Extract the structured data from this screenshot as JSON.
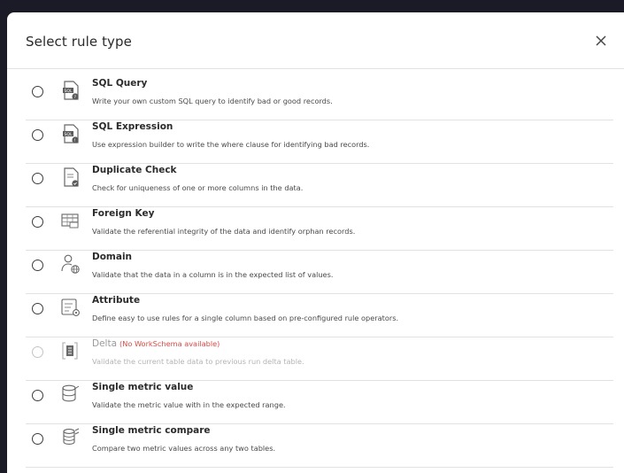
{
  "dialog": {
    "title": "Select rule type",
    "close_icon": "close-icon"
  },
  "rule_types": [
    {
      "name": "SQL Query",
      "description": "Write your own custom SQL query to identify bad or good records.",
      "icon": "sql-query-icon"
    },
    {
      "name": "SQL Expression",
      "description": "Use expression builder to write the where clause for identifying bad records.",
      "icon": "sql-expression-icon"
    },
    {
      "name": "Duplicate Check",
      "description": "Check for uniqueness of one or more columns in the data.",
      "icon": "duplicate-check-icon"
    },
    {
      "name": "Foreign Key",
      "description": "Validate the referential integrity of the data and identify orphan records.",
      "icon": "foreign-key-icon"
    },
    {
      "name": "Domain",
      "description": "Validate that the data in a column is in the expected list of values.",
      "icon": "domain-icon"
    },
    {
      "name": "Attribute",
      "description": "Define easy to use rules for a single column based on pre-configured rule operators.",
      "icon": "attribute-icon"
    },
    {
      "name": "Delta",
      "note": "(No WorkSchema available)",
      "description": "Validate the current table data to previous run delta table.",
      "icon": "delta-icon",
      "disabled": true
    },
    {
      "name": "Single metric value",
      "description": "Validate the metric value with in the expected range.",
      "icon": "single-metric-value-icon"
    },
    {
      "name": "Single metric compare",
      "description": "Compare two metric values across any two tables.",
      "icon": "single-metric-compare-icon"
    }
  ],
  "colors": {
    "overlay": "#1b1b28",
    "note": "#d84a45"
  }
}
